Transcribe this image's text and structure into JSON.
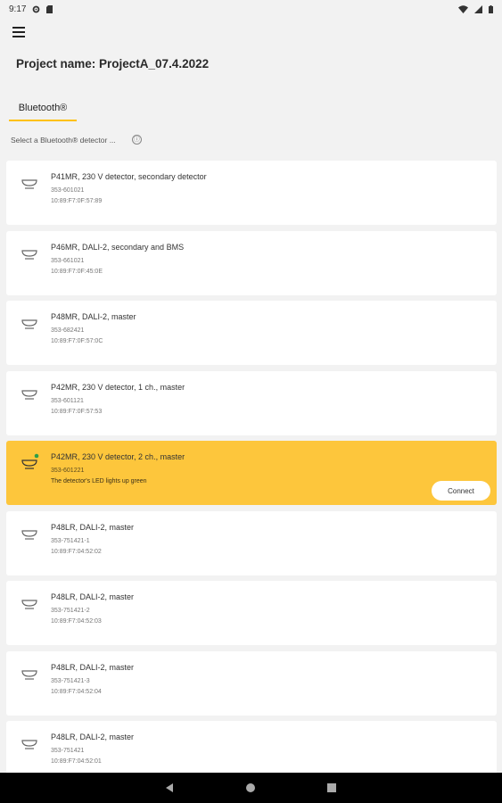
{
  "status_bar": {
    "time": "9:17"
  },
  "header": {
    "project_title": "Project name: ProjectA_07.4.2022"
  },
  "tabs": [
    {
      "label": "Bluetooth®"
    }
  ],
  "prompt": {
    "text": "Select a Bluetooth® detector ...",
    "info_icon": "ⓘ"
  },
  "detectors": [
    {
      "title": "P41MR, 230 V detector, secondary detector",
      "id": "353-601021",
      "mac": "10:89:F7:0F:57:89"
    },
    {
      "title": "P46MR, DALI-2, secondary and BMS",
      "id": "353-661021",
      "mac": "10:89:F7:0F:45:0E"
    },
    {
      "title": "P48MR, DALI-2, master",
      "id": "353-682421",
      "mac": "10:89:F7:0F:57:0C"
    },
    {
      "title": "P42MR, 230 V detector, 1 ch., master",
      "id": "353-601121",
      "mac": "10:89:F7:0F:57:53"
    },
    {
      "title": "P42MR, 230 V detector, 2 ch., master",
      "id": "353-601221",
      "mac": "The detector's LED lights up green",
      "selected": true,
      "connect_label": "Connect"
    },
    {
      "title": "P48LR, DALI-2, master",
      "id": "353-751421-1",
      "mac": "10:89:F7:04:52:02"
    },
    {
      "title": "P48LR, DALI-2, master",
      "id": "353-751421-2",
      "mac": "10:89:F7:04:52:03"
    },
    {
      "title": "P48LR, DALI-2, master",
      "id": "353-751421-3",
      "mac": "10:89:F7:04:52:04"
    },
    {
      "title": "P48LR, DALI-2, master",
      "id": "353-751421",
      "mac": "10:89:F7:04:52:01"
    }
  ],
  "colors": {
    "accent": "#fdc63c",
    "tab_underline": "#ffc107",
    "background": "#f2f2f2",
    "card": "#ffffff"
  }
}
